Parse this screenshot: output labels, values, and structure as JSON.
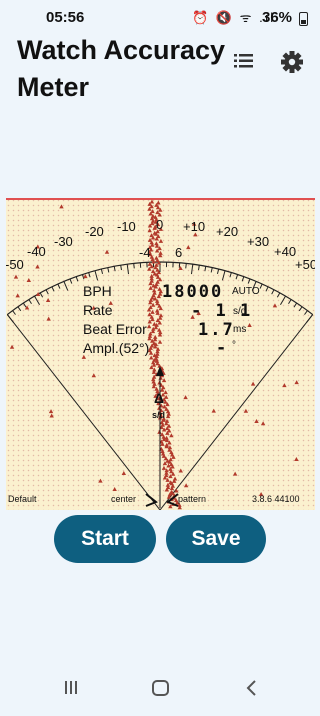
{
  "status": {
    "time": "05:56",
    "battery": "36%",
    "icons": "⏰ 🔇 ᯤ .ıl"
  },
  "app": {
    "title": "Watch Accuracy Meter"
  },
  "meter": {
    "labels": {
      "bph": "BPH",
      "rate": "Rate",
      "beat_error": "Beat Error",
      "amplitude": "Ampl.(52°)"
    },
    "values": {
      "bph": "18000",
      "bph_mode": "AUTO",
      "rate": "- 1 1",
      "rate_unit": "s/d",
      "beat_error": "1.7",
      "beat_error_unit": "ms",
      "amplitude": "-",
      "amplitude_unit": "°"
    },
    "scale": [
      "-50",
      "-40",
      "-30",
      "-20",
      "-10",
      "-4",
      "0",
      "6",
      "+10",
      "+20",
      "+30",
      "+40",
      "+50"
    ],
    "delta_symbol": "Δ",
    "delta_unit": "s/d",
    "bottom": {
      "left": "Default",
      "center": "center",
      "pattern": "pattern",
      "version": "3.8.6 44100"
    }
  },
  "buttons": {
    "start": "Start",
    "save": "Save"
  },
  "colors": {
    "accent": "#0e5f80",
    "trace": "#b23a2c",
    "meter_bg": "#fbf1cf",
    "top_line": "#e05050"
  }
}
